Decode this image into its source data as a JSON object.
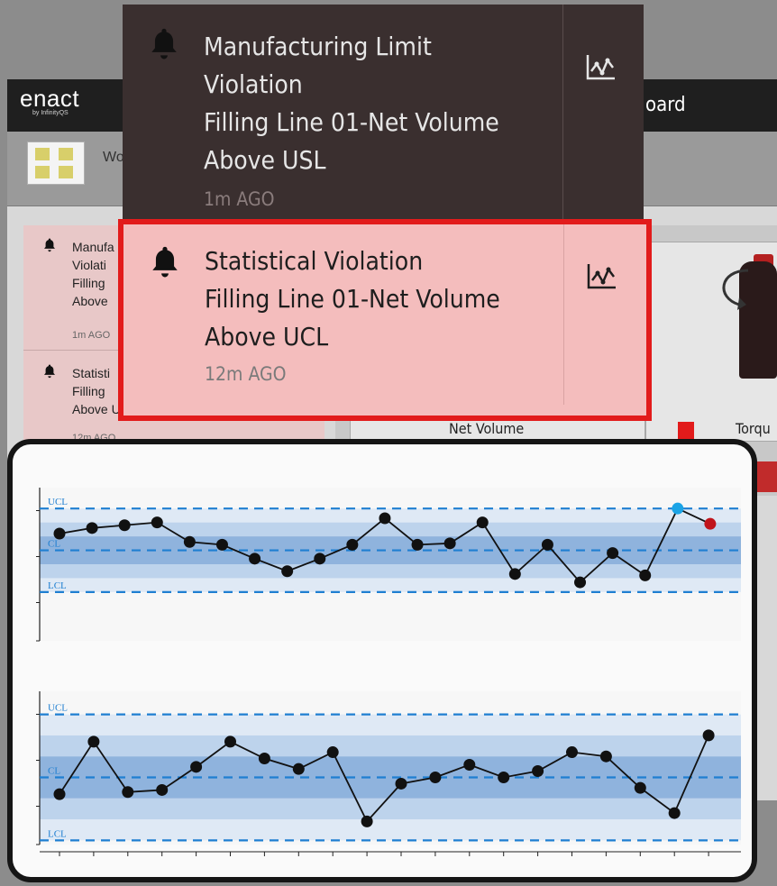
{
  "app": {
    "logo_main": "enact",
    "logo_sub": "by InfinityQS",
    "dashboard_title_fragment": "oard",
    "toolbar_text_fragment": "Wo"
  },
  "notifications": [
    {
      "lines": [
        "Manufacturing Limit",
        "Violation",
        "Filling Line 01-Net Volume",
        "Above USL"
      ],
      "time": "1m AGO",
      "icon": "bell-icon",
      "action_icon": "line-chart-icon",
      "active": false
    },
    {
      "lines": [
        "Statistical Violation",
        "Filling Line 01-Net Volume",
        "Above UCL"
      ],
      "time": "12m AGO",
      "icon": "bell-icon",
      "action_icon": "line-chart-icon",
      "active": true
    }
  ],
  "left_panel": [
    {
      "lines": [
        "Manufa",
        "Violati",
        "Filling",
        "Above"
      ],
      "time": "1m AGO"
    },
    {
      "lines": [
        "Statisti",
        "Filling",
        "Above UCL"
      ],
      "time": "12m AGO"
    }
  ],
  "cards": {
    "net_volume_label": "Net Volume",
    "torque_label_fragment": "Torqu"
  },
  "colors": {
    "highlight_border": "#e21b1b",
    "active_notification_bg": "#f4bdbd",
    "dropdown_bg": "#3a2f2f",
    "control_line": "#1f7fd1",
    "violation_point": "#1ba4e6",
    "out_of_control_point": "#c0141b"
  },
  "chart_data": [
    {
      "type": "line",
      "name": "xbar",
      "control_labels": [
        "UCL",
        "CL",
        "LCL"
      ],
      "ucl": 3,
      "cl": 0,
      "lcl": -3,
      "ylim": [
        -6.5,
        4.5
      ],
      "y": [
        1.2,
        1.6,
        1.8,
        2.0,
        0.6,
        0.4,
        -0.6,
        -1.5,
        -0.6,
        0.4,
        2.3,
        0.4,
        0.5,
        2.0,
        -1.7,
        0.4,
        -2.3,
        -0.2,
        -1.8,
        3.0,
        1.9
      ],
      "highlight": {
        "19": "violation",
        "20": "out-of-control"
      },
      "grid": true
    },
    {
      "type": "line",
      "name": "range",
      "control_labels": [
        "UCL",
        "CL",
        "LCL"
      ],
      "ucl": 3,
      "cl": 0,
      "lcl": -3,
      "ylim": [
        -3.2,
        4.1
      ],
      "y": [
        -0.8,
        1.7,
        -0.7,
        -0.6,
        0.5,
        1.7,
        0.9,
        0.4,
        1.2,
        -2.1,
        -0.3,
        0.0,
        0.6,
        0.0,
        0.3,
        1.2,
        1.0,
        -0.5,
        -1.7,
        2.0
      ],
      "grid": true
    }
  ]
}
